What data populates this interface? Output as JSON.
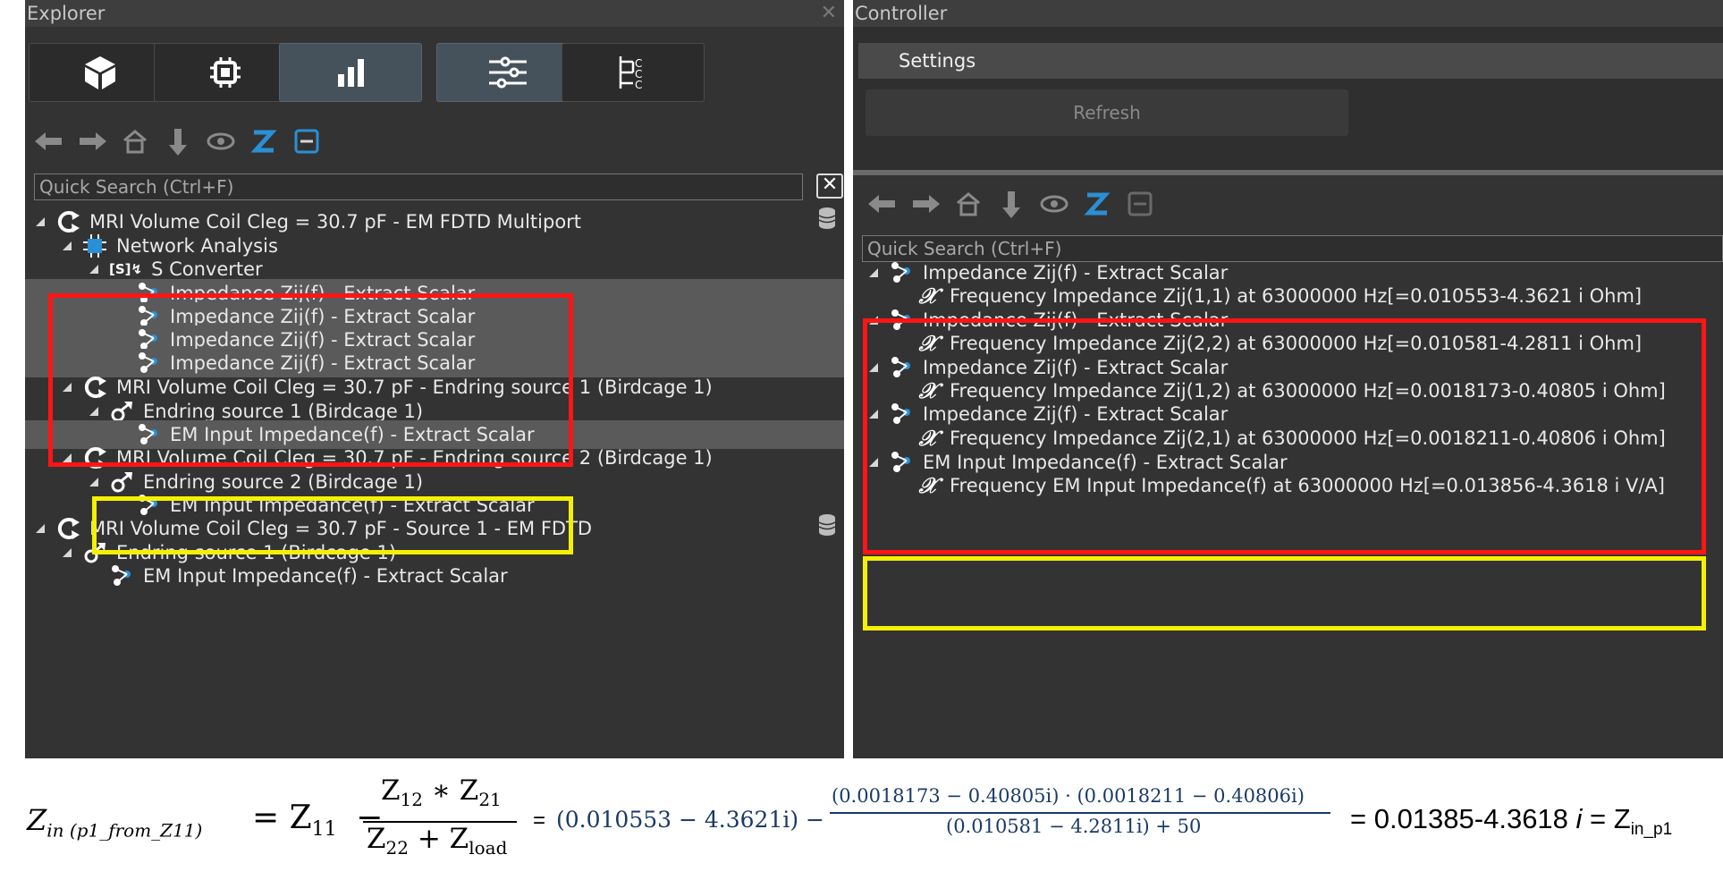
{
  "explorer": {
    "title": "Explorer",
    "close_glyph": "✕",
    "tabs": [
      {
        "name": "cube-icon",
        "active": false
      },
      {
        "name": "chip-icon",
        "active": false
      },
      {
        "name": "bar-chart-icon",
        "active": true
      },
      {
        "name": "sliders-icon",
        "active": true
      },
      {
        "name": "hierarchy-icon",
        "active": false
      }
    ],
    "search_placeholder": "Quick Search (Ctrl+F)",
    "clear_glyph": "✕",
    "tree": [
      {
        "label": "MRI Volume Coil Cleg = 30.7 pF - EM FDTD Multiport",
        "level": 0
      },
      {
        "label": "Network Analysis",
        "level": 1
      },
      {
        "prefix": "[S]",
        "label": "S Converter",
        "level": 2
      },
      {
        "label": "Impedance Zij(f) - Extract Scalar",
        "level": 3
      },
      {
        "label": "Impedance Zij(f) - Extract Scalar",
        "level": 3
      },
      {
        "label": "Impedance Zij(f) - Extract Scalar",
        "level": 3
      },
      {
        "label": "Impedance Zij(f) - Extract Scalar",
        "level": 3
      },
      {
        "label": "MRI Volume Coil Cleg = 30.7 pF - Endring source 1  (Birdcage 1)",
        "level": 1
      },
      {
        "label": "Endring source 1  (Birdcage 1)",
        "level": 2
      },
      {
        "label": "EM Input Impedance(f) - Extract Scalar",
        "level": 3
      },
      {
        "label": "MRI Volume Coil Cleg = 30.7 pF - Endring source 2  (Birdcage 1)",
        "level": 1
      },
      {
        "label": "Endring source 2  (Birdcage 1)",
        "level": 2
      },
      {
        "label": "EM Input Impedance(f) - Extract Scalar",
        "level": 3
      },
      {
        "label": "MRI Volume Coil Cleg = 30.7 pF - Source 1 - EM FDTD",
        "level": 0
      },
      {
        "label": "Endring source 1  (Birdcage 1)",
        "level": 1
      },
      {
        "label": "EM Input Impedance(f) - Extract Scalar",
        "level": 2
      }
    ]
  },
  "controller": {
    "title": "Controller",
    "settings_tab": "Settings",
    "refresh_label": "Refresh",
    "search_placeholder": "Quick Search (Ctrl+F)",
    "tree": [
      {
        "label": "Impedance Zij(f) - Extract Scalar",
        "level": 0
      },
      {
        "label": "Frequency Impedance Zij(1,1) at 63000000 Hz[=0.010553-4.3621 i Ohm]",
        "level": 1
      },
      {
        "label": "Impedance Zij(f) - Extract Scalar",
        "level": 0
      },
      {
        "label": "Frequency Impedance Zij(2,2) at 63000000 Hz[=0.010581-4.2811 i Ohm]",
        "level": 1
      },
      {
        "label": "Impedance Zij(f) - Extract Scalar",
        "level": 0
      },
      {
        "label": "Frequency Impedance Zij(1,2) at 63000000 Hz[=0.0018173-0.40805 i Ohm]",
        "level": 1
      },
      {
        "label": "Impedance Zij(f) - Extract Scalar",
        "level": 0
      },
      {
        "label": "Frequency Impedance Zij(2,1) at 63000000 Hz[=0.0018211-0.40806 i Ohm]",
        "level": 1
      },
      {
        "label": "EM Input Impedance(f) - Extract Scalar",
        "level": 0
      },
      {
        "label": "Frequency EM Input Impedance(f) at 63000000 Hz[=0.013856-4.3618 i V/A]",
        "level": 1
      }
    ]
  },
  "colors": {
    "highlight_red": "#ff1515",
    "highlight_yellow": "#f5f000",
    "accent_blue": "#2b8fd6"
  },
  "formula": {
    "lhs_main": "Z",
    "lhs_sub": "in (p1_from_Z11)",
    "eq1": "= Z",
    "z11_sub": "11",
    "minus": "−",
    "num": "Z",
    "num_sub1": "12",
    "num_mid": " ∗ Z",
    "num_sub2": "21",
    "den": "Z",
    "den_sub1": "22",
    "den_mid": " + Z",
    "den_sub2": "load",
    "eq2": "=",
    "term1": "(0.010553 − 4.3621i) −",
    "frac2_num": "(0.0018173 − 0.40805i) · (0.0018211 − 0.40806i)",
    "frac2_den": "(0.010581 − 4.2811i) + 50",
    "result_prefix": "= 0.01385-4.3618 ",
    "result_i": "i",
    "result_eq": " = Z",
    "result_sub": "in_p1"
  }
}
